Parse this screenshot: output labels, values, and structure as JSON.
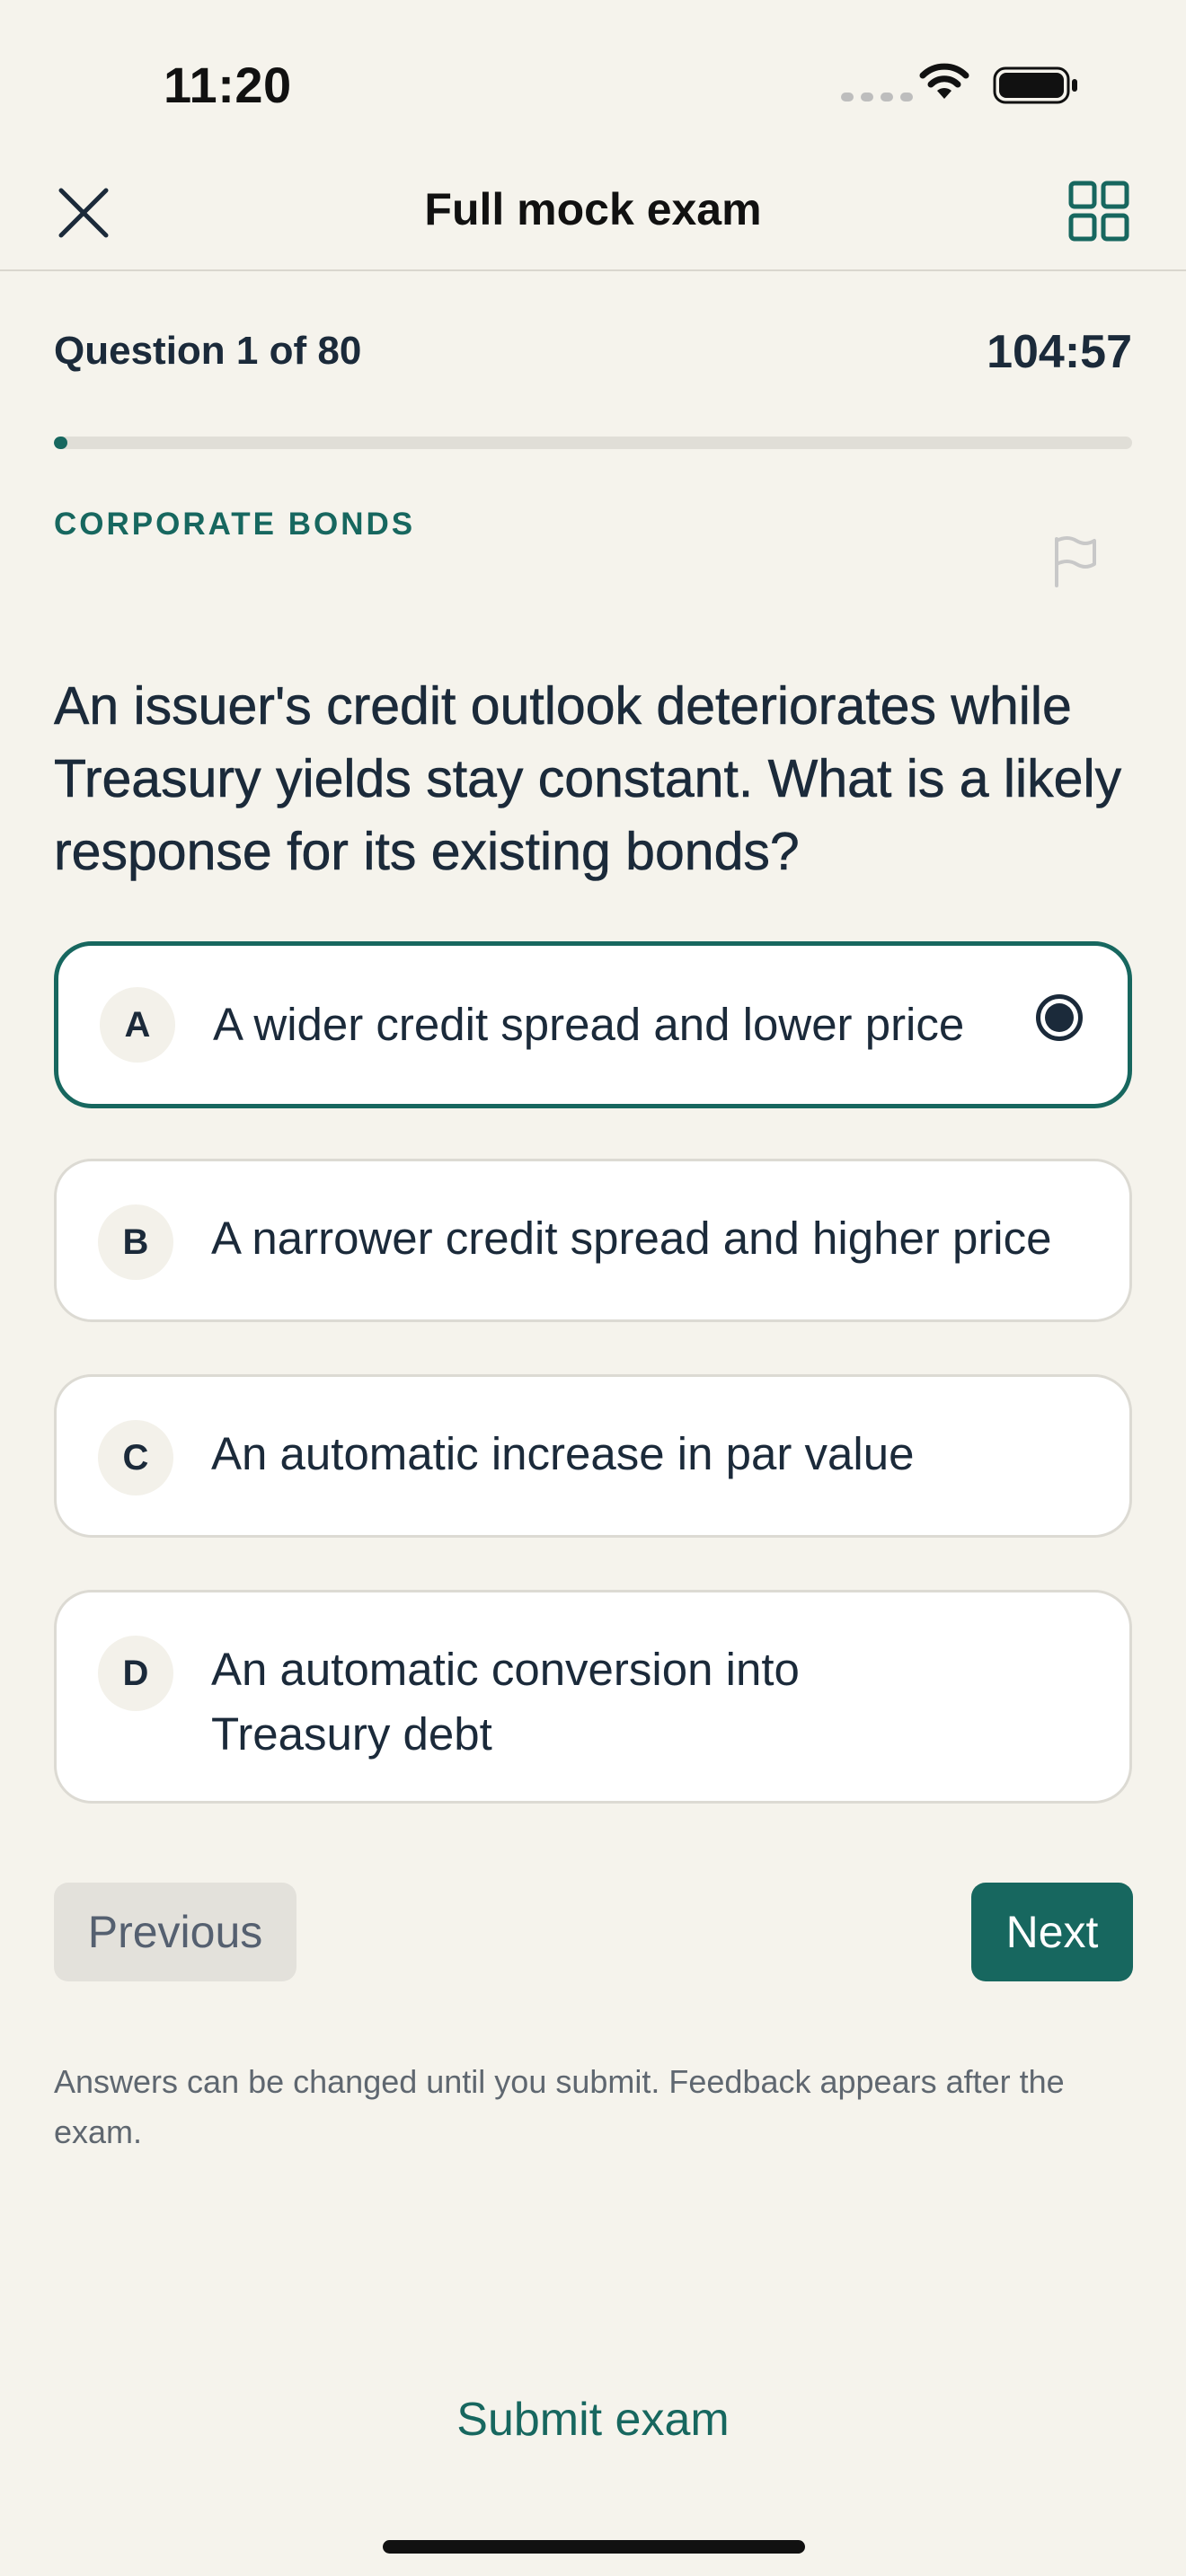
{
  "status_bar": {
    "time": "11:20"
  },
  "header": {
    "title": "Full mock exam"
  },
  "progress": {
    "counter": "Question 1 of 80",
    "timer": "104:57",
    "fraction": 0.0125
  },
  "question": {
    "topic": "CORPORATE BONDS",
    "text": "An issuer's credit outlook deteriorates while Treasury yields stay constant. What is a likely response for its existing bonds?"
  },
  "options": [
    {
      "letter": "A",
      "text": "A wider credit spread and lower price",
      "selected": true
    },
    {
      "letter": "B",
      "text": "A narrower credit spread and higher price",
      "selected": false
    },
    {
      "letter": "C",
      "text": "An automatic increase in par value",
      "selected": false
    },
    {
      "letter": "D",
      "text": "An automatic conversion into Treasury debt",
      "selected": false
    }
  ],
  "navigation": {
    "previous_label": "Previous",
    "next_label": "Next"
  },
  "note": "Answers can be changed until you submit. Feedback appears after the exam.",
  "submit_label": "Submit exam",
  "colors": {
    "accent": "#17675F",
    "background": "#F5F3EC",
    "text": "#1B2A3A"
  },
  "icons": [
    "close-icon",
    "grid-icon",
    "flag-icon",
    "wifi-icon",
    "battery-icon"
  ]
}
